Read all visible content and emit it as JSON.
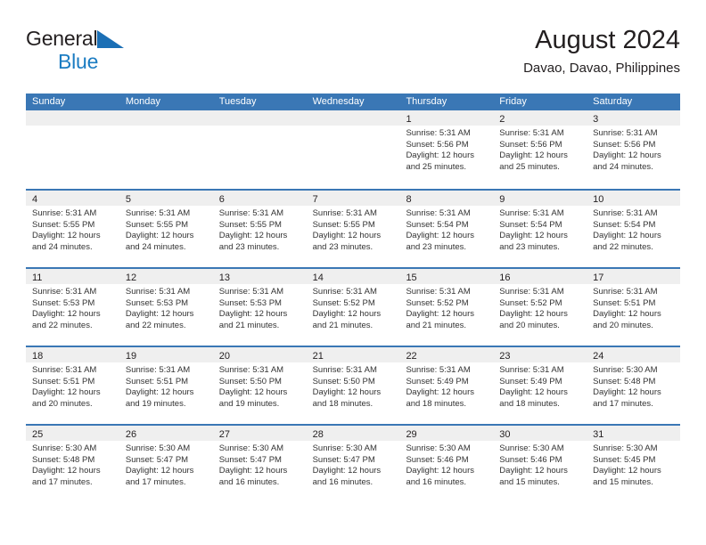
{
  "brand": {
    "name_part1": "General",
    "name_part2": "Blue",
    "triangle_color": "#1b6fb5",
    "text_color": "#231f20",
    "blue_color": "#1b7cc2"
  },
  "header": {
    "title": "August 2024",
    "subtitle": "Davao, Davao, Philippines"
  },
  "colors": {
    "header_blue": "#3a77b5",
    "daynum_band": "#efefef",
    "cell_text": "#333333"
  },
  "weekdays": [
    "Sunday",
    "Monday",
    "Tuesday",
    "Wednesday",
    "Thursday",
    "Friday",
    "Saturday"
  ],
  "weeks": [
    [
      {
        "day": "",
        "empty": true
      },
      {
        "day": "",
        "empty": true
      },
      {
        "day": "",
        "empty": true
      },
      {
        "day": "",
        "empty": true
      },
      {
        "day": "1",
        "sunrise": "Sunrise: 5:31 AM",
        "sunset": "Sunset: 5:56 PM",
        "daylight1": "Daylight: 12 hours",
        "daylight2": "and 25 minutes."
      },
      {
        "day": "2",
        "sunrise": "Sunrise: 5:31 AM",
        "sunset": "Sunset: 5:56 PM",
        "daylight1": "Daylight: 12 hours",
        "daylight2": "and 25 minutes."
      },
      {
        "day": "3",
        "sunrise": "Sunrise: 5:31 AM",
        "sunset": "Sunset: 5:56 PM",
        "daylight1": "Daylight: 12 hours",
        "daylight2": "and 24 minutes."
      }
    ],
    [
      {
        "day": "4",
        "sunrise": "Sunrise: 5:31 AM",
        "sunset": "Sunset: 5:55 PM",
        "daylight1": "Daylight: 12 hours",
        "daylight2": "and 24 minutes."
      },
      {
        "day": "5",
        "sunrise": "Sunrise: 5:31 AM",
        "sunset": "Sunset: 5:55 PM",
        "daylight1": "Daylight: 12 hours",
        "daylight2": "and 24 minutes."
      },
      {
        "day": "6",
        "sunrise": "Sunrise: 5:31 AM",
        "sunset": "Sunset: 5:55 PM",
        "daylight1": "Daylight: 12 hours",
        "daylight2": "and 23 minutes."
      },
      {
        "day": "7",
        "sunrise": "Sunrise: 5:31 AM",
        "sunset": "Sunset: 5:55 PM",
        "daylight1": "Daylight: 12 hours",
        "daylight2": "and 23 minutes."
      },
      {
        "day": "8",
        "sunrise": "Sunrise: 5:31 AM",
        "sunset": "Sunset: 5:54 PM",
        "daylight1": "Daylight: 12 hours",
        "daylight2": "and 23 minutes."
      },
      {
        "day": "9",
        "sunrise": "Sunrise: 5:31 AM",
        "sunset": "Sunset: 5:54 PM",
        "daylight1": "Daylight: 12 hours",
        "daylight2": "and 23 minutes."
      },
      {
        "day": "10",
        "sunrise": "Sunrise: 5:31 AM",
        "sunset": "Sunset: 5:54 PM",
        "daylight1": "Daylight: 12 hours",
        "daylight2": "and 22 minutes."
      }
    ],
    [
      {
        "day": "11",
        "sunrise": "Sunrise: 5:31 AM",
        "sunset": "Sunset: 5:53 PM",
        "daylight1": "Daylight: 12 hours",
        "daylight2": "and 22 minutes."
      },
      {
        "day": "12",
        "sunrise": "Sunrise: 5:31 AM",
        "sunset": "Sunset: 5:53 PM",
        "daylight1": "Daylight: 12 hours",
        "daylight2": "and 22 minutes."
      },
      {
        "day": "13",
        "sunrise": "Sunrise: 5:31 AM",
        "sunset": "Sunset: 5:53 PM",
        "daylight1": "Daylight: 12 hours",
        "daylight2": "and 21 minutes."
      },
      {
        "day": "14",
        "sunrise": "Sunrise: 5:31 AM",
        "sunset": "Sunset: 5:52 PM",
        "daylight1": "Daylight: 12 hours",
        "daylight2": "and 21 minutes."
      },
      {
        "day": "15",
        "sunrise": "Sunrise: 5:31 AM",
        "sunset": "Sunset: 5:52 PM",
        "daylight1": "Daylight: 12 hours",
        "daylight2": "and 21 minutes."
      },
      {
        "day": "16",
        "sunrise": "Sunrise: 5:31 AM",
        "sunset": "Sunset: 5:52 PM",
        "daylight1": "Daylight: 12 hours",
        "daylight2": "and 20 minutes."
      },
      {
        "day": "17",
        "sunrise": "Sunrise: 5:31 AM",
        "sunset": "Sunset: 5:51 PM",
        "daylight1": "Daylight: 12 hours",
        "daylight2": "and 20 minutes."
      }
    ],
    [
      {
        "day": "18",
        "sunrise": "Sunrise: 5:31 AM",
        "sunset": "Sunset: 5:51 PM",
        "daylight1": "Daylight: 12 hours",
        "daylight2": "and 20 minutes."
      },
      {
        "day": "19",
        "sunrise": "Sunrise: 5:31 AM",
        "sunset": "Sunset: 5:51 PM",
        "daylight1": "Daylight: 12 hours",
        "daylight2": "and 19 minutes."
      },
      {
        "day": "20",
        "sunrise": "Sunrise: 5:31 AM",
        "sunset": "Sunset: 5:50 PM",
        "daylight1": "Daylight: 12 hours",
        "daylight2": "and 19 minutes."
      },
      {
        "day": "21",
        "sunrise": "Sunrise: 5:31 AM",
        "sunset": "Sunset: 5:50 PM",
        "daylight1": "Daylight: 12 hours",
        "daylight2": "and 18 minutes."
      },
      {
        "day": "22",
        "sunrise": "Sunrise: 5:31 AM",
        "sunset": "Sunset: 5:49 PM",
        "daylight1": "Daylight: 12 hours",
        "daylight2": "and 18 minutes."
      },
      {
        "day": "23",
        "sunrise": "Sunrise: 5:31 AM",
        "sunset": "Sunset: 5:49 PM",
        "daylight1": "Daylight: 12 hours",
        "daylight2": "and 18 minutes."
      },
      {
        "day": "24",
        "sunrise": "Sunrise: 5:30 AM",
        "sunset": "Sunset: 5:48 PM",
        "daylight1": "Daylight: 12 hours",
        "daylight2": "and 17 minutes."
      }
    ],
    [
      {
        "day": "25",
        "sunrise": "Sunrise: 5:30 AM",
        "sunset": "Sunset: 5:48 PM",
        "daylight1": "Daylight: 12 hours",
        "daylight2": "and 17 minutes."
      },
      {
        "day": "26",
        "sunrise": "Sunrise: 5:30 AM",
        "sunset": "Sunset: 5:47 PM",
        "daylight1": "Daylight: 12 hours",
        "daylight2": "and 17 minutes."
      },
      {
        "day": "27",
        "sunrise": "Sunrise: 5:30 AM",
        "sunset": "Sunset: 5:47 PM",
        "daylight1": "Daylight: 12 hours",
        "daylight2": "and 16 minutes."
      },
      {
        "day": "28",
        "sunrise": "Sunrise: 5:30 AM",
        "sunset": "Sunset: 5:47 PM",
        "daylight1": "Daylight: 12 hours",
        "daylight2": "and 16 minutes."
      },
      {
        "day": "29",
        "sunrise": "Sunrise: 5:30 AM",
        "sunset": "Sunset: 5:46 PM",
        "daylight1": "Daylight: 12 hours",
        "daylight2": "and 16 minutes."
      },
      {
        "day": "30",
        "sunrise": "Sunrise: 5:30 AM",
        "sunset": "Sunset: 5:46 PM",
        "daylight1": "Daylight: 12 hours",
        "daylight2": "and 15 minutes."
      },
      {
        "day": "31",
        "sunrise": "Sunrise: 5:30 AM",
        "sunset": "Sunset: 5:45 PM",
        "daylight1": "Daylight: 12 hours",
        "daylight2": "and 15 minutes."
      }
    ]
  ]
}
